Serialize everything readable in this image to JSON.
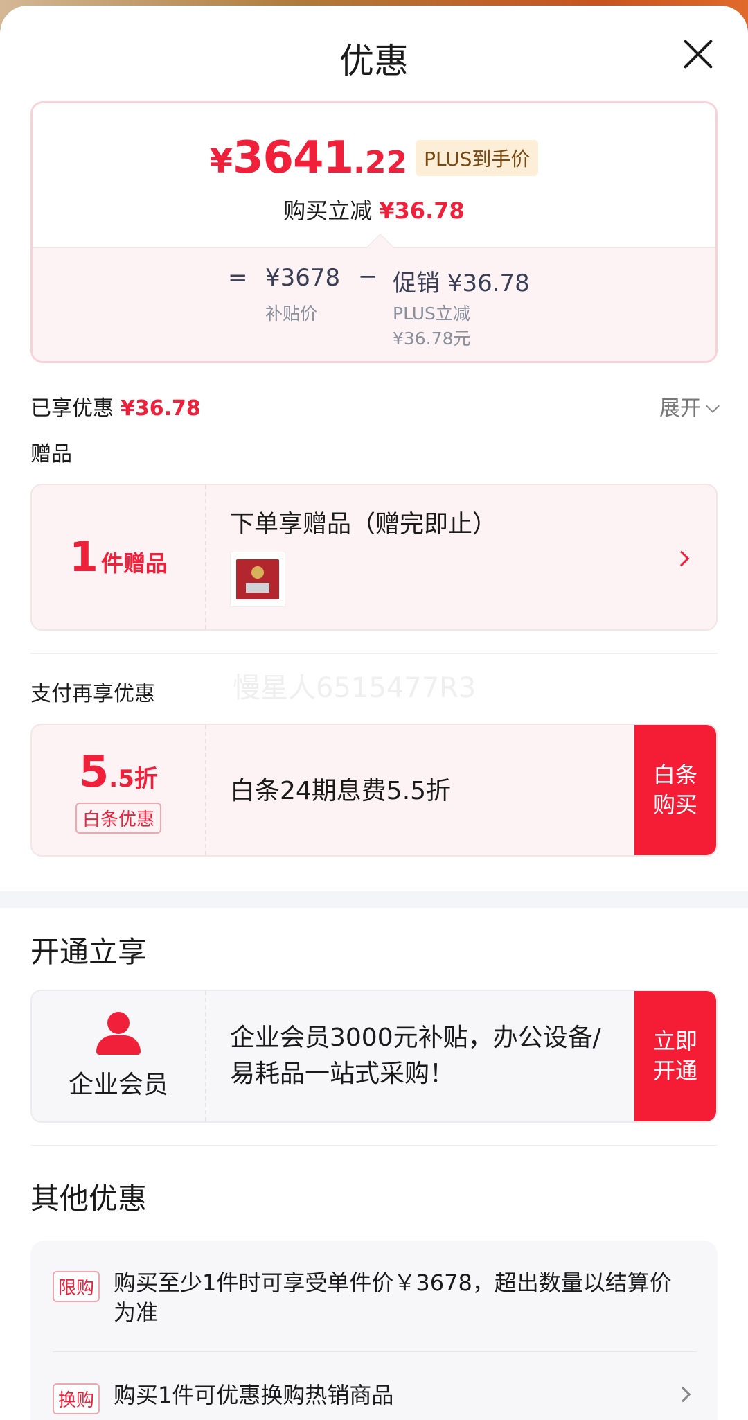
{
  "header": {
    "title": "优惠"
  },
  "price_card": {
    "currency": "¥",
    "price_int": "3641",
    "price_dec": ".22",
    "plus_tag": "PLUS到手价",
    "reduce_label": "购买立减",
    "reduce_amount": "¥36.78",
    "calc_eq": "=",
    "subsidy_price": "¥3678",
    "subsidy_label": "补贴价",
    "calc_minus": "−",
    "promo_label": "促销 ¥36.78",
    "promo_sub1": "PLUS立减",
    "promo_sub2": "¥36.78元"
  },
  "enjoyed": {
    "label": "已享优惠",
    "amount": "¥36.78",
    "expand": "展开"
  },
  "gift": {
    "section": "赠品",
    "count": "1",
    "count_unit": "件赠品",
    "title": "下单享赠品（赠完即止）"
  },
  "watermark": "慢星人6515477R3",
  "pay": {
    "section": "支付再享优惠",
    "discount_main": "5",
    "discount_rest": ".5折",
    "tag": "白条优惠",
    "text": "白条24期息费5.5折",
    "action": "白条购买"
  },
  "activate": {
    "section": "开通立享",
    "member_label": "企业会员",
    "text": " 企业会员3000元补贴，办公设备/易耗品一站式采购！",
    "action": "立即开通"
  },
  "other": {
    "section": "其他优惠",
    "items": [
      {
        "tag": "限购",
        "text": "购买至少1件时可享受单件价￥3678，超出数量以结算价为准"
      },
      {
        "tag": "换购",
        "text": "购买1件可优惠换购热销商品"
      }
    ]
  },
  "colors": {
    "accent": "#f0203a",
    "action_bg": "#f51d36",
    "plus_tag_bg": "#fdeed8"
  }
}
